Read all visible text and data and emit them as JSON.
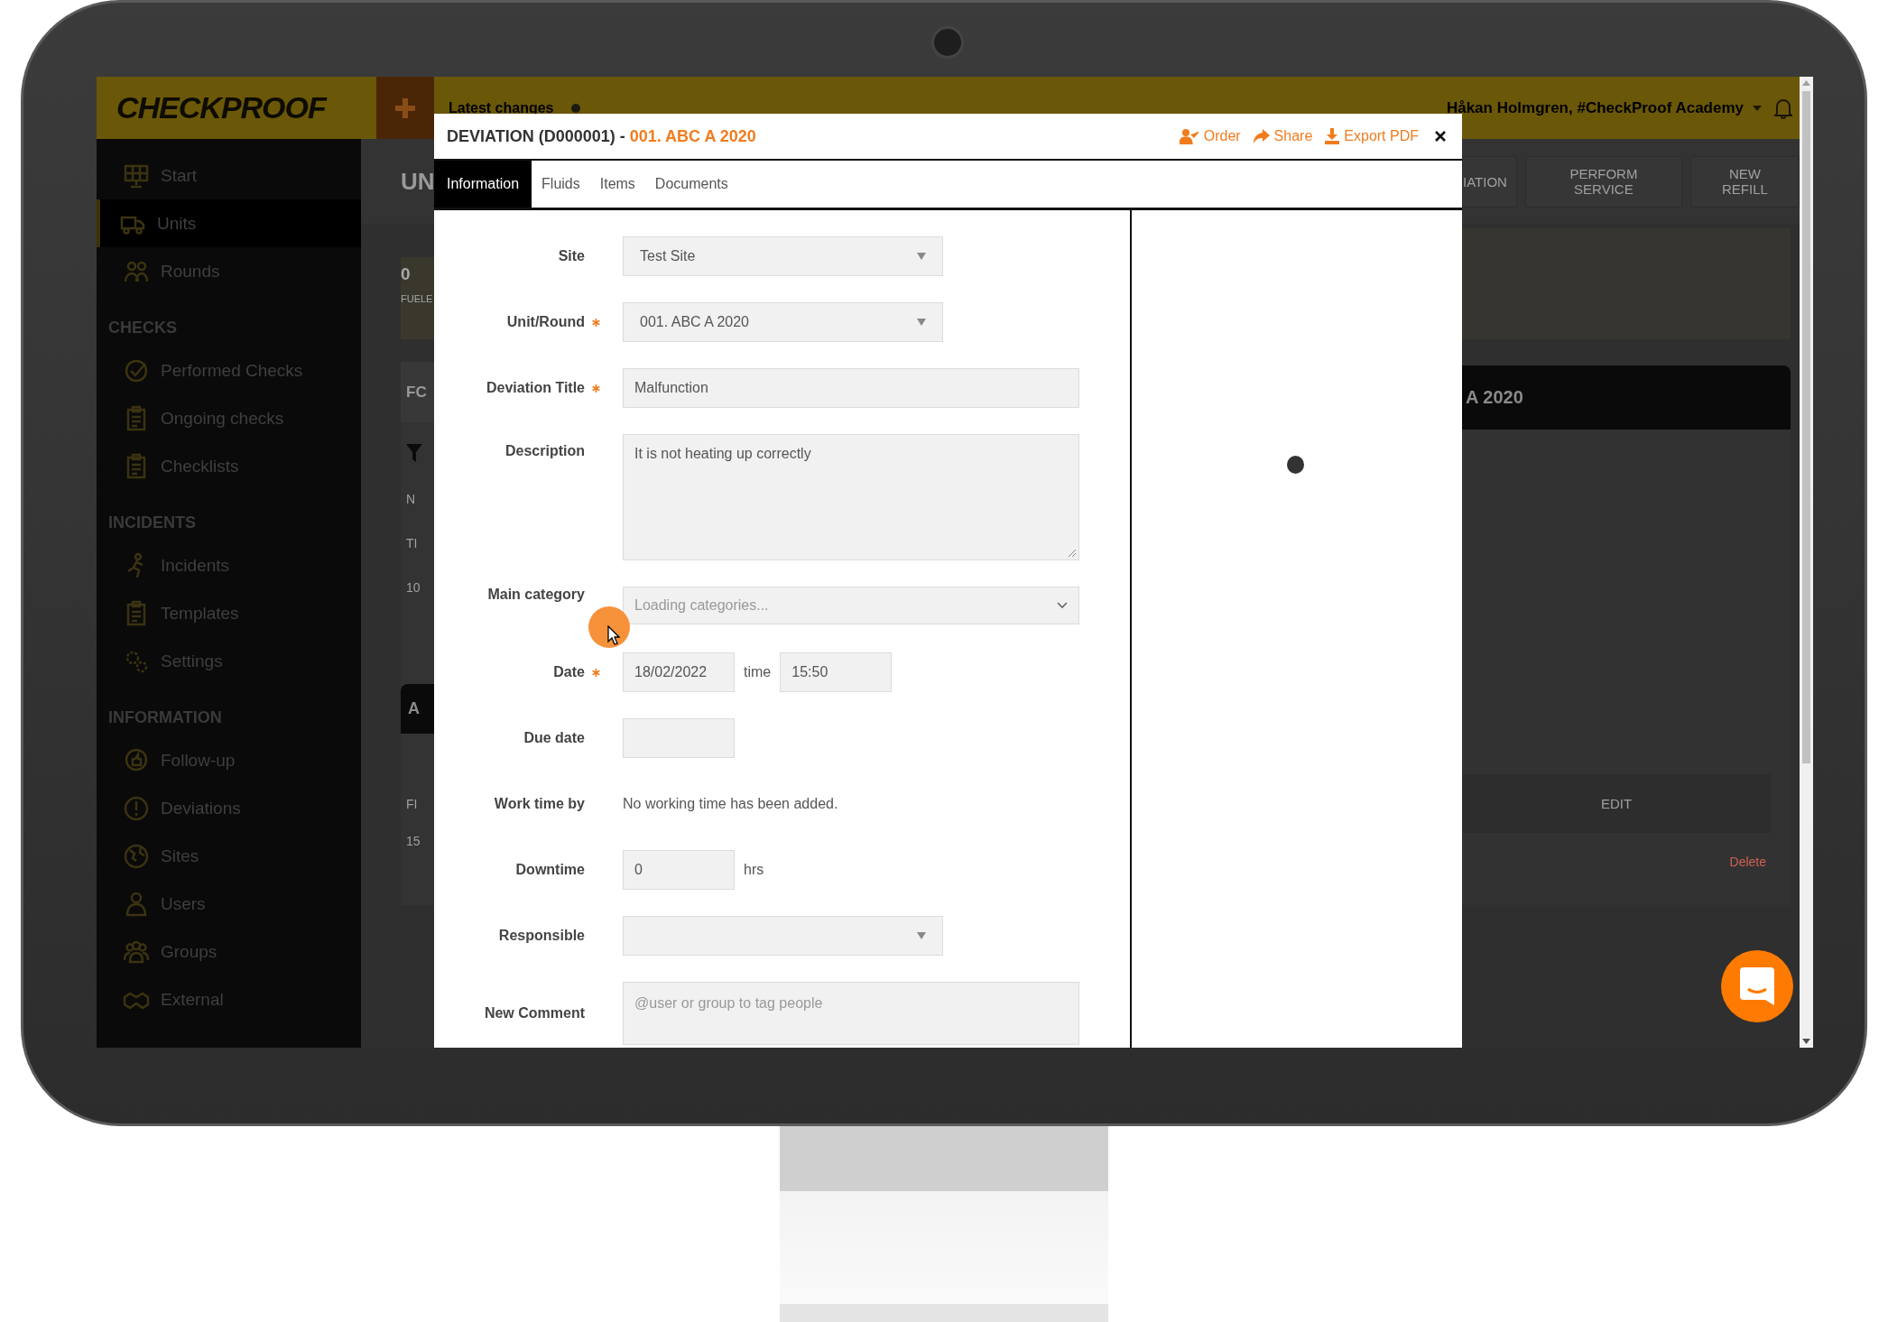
{
  "topbar": {
    "logo": "CHECKPROOF",
    "latest_changes": "Latest changes",
    "user": "Håkan Holmgren, #CheckProof Academy"
  },
  "sidebar": {
    "groups": [
      {
        "items": [
          {
            "label": "Start",
            "selected": false
          },
          {
            "label": "Units",
            "selected": true
          },
          {
            "label": "Rounds",
            "selected": false
          }
        ]
      },
      {
        "heading": "CHECKS",
        "items": [
          {
            "label": "Performed Checks",
            "selected": false
          },
          {
            "label": "Ongoing checks",
            "selected": false
          },
          {
            "label": "Checklists",
            "selected": false
          }
        ]
      },
      {
        "heading": "INCIDENTS",
        "items": [
          {
            "label": "Incidents",
            "selected": false
          },
          {
            "label": "Templates",
            "selected": false
          },
          {
            "label": "Settings",
            "selected": false
          }
        ]
      },
      {
        "heading": "INFORMATION",
        "items": [
          {
            "label": "Follow-up",
            "selected": false
          },
          {
            "label": "Deviations",
            "selected": false
          },
          {
            "label": "Sites",
            "selected": false
          },
          {
            "label": "Users",
            "selected": false
          },
          {
            "label": "Groups",
            "selected": false
          },
          {
            "label": "External",
            "selected": false
          }
        ]
      }
    ]
  },
  "page_behind": {
    "title": "UN",
    "stat_value": "0",
    "stat_label": "FUELE",
    "card_heading": "FC",
    "rows": [
      "N",
      "TI",
      "10"
    ],
    "section_bar": "A",
    "rows_2": [
      "FI",
      "15"
    ],
    "actions": [
      "IATION",
      "PERFORM SERVICE",
      "NEW REFILL"
    ],
    "unit_bar": "A 2020",
    "edit_button": "EDIT",
    "delete_link": "Delete"
  },
  "modal": {
    "title": "DEVIATION (D000001) - ",
    "title_unit": "001. ABC A 2020",
    "actions": [
      {
        "label": "Order"
      },
      {
        "label": "Share"
      },
      {
        "label": "Export PDF"
      }
    ],
    "tabs": [
      {
        "label": "Information",
        "selected": true
      },
      {
        "label": "Fluids",
        "selected": false
      },
      {
        "label": "Items",
        "selected": false
      },
      {
        "label": "Documents",
        "selected": false
      }
    ],
    "fields": [
      {
        "label": "Site",
        "required": false,
        "kind": "select",
        "value": "Test Site"
      },
      {
        "label": "Unit/Round",
        "required": true,
        "kind": "select",
        "value": "001. ABC A 2020"
      },
      {
        "label": "Deviation Title",
        "required": true,
        "kind": "input",
        "value": "Malfunction"
      },
      {
        "label": "Description",
        "required": false,
        "kind": "textarea",
        "value": "It is not heating up correctly"
      },
      {
        "label": "Main category",
        "required": false,
        "kind": "dropdown",
        "placeholder": "Loading categories..."
      },
      {
        "label": "Date",
        "required": true,
        "kind": "datetime",
        "value": "18/02/2022",
        "time_label": "time",
        "time_value": "15:50"
      },
      {
        "label": "Due date",
        "required": false,
        "kind": "small_input"
      },
      {
        "label": "Work time by",
        "required": false,
        "kind": "text",
        "value": "No working time has been added."
      },
      {
        "label": "Downtime",
        "required": false,
        "kind": "input_unit",
        "value": "0",
        "unit": "hrs"
      },
      {
        "label": "Responsible",
        "required": false,
        "kind": "select"
      },
      {
        "label": "New Comment",
        "required": false,
        "kind": "comment",
        "placeholder": "@user or group to tag people"
      }
    ]
  }
}
